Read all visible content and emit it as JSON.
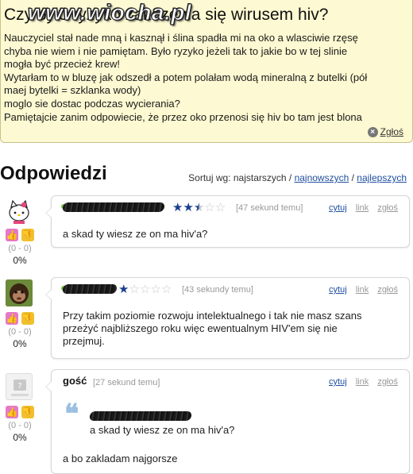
{
  "question": {
    "title": "Czy było ryzyko zakazenia się wirusem hiv?",
    "watermark": "www.wiocha.pl",
    "lines": [
      "Nauczyciel stał nade mną i kasznął i ślina spadła mi na oko a wlasciwie rzęsę",
      "chyba nie wiem i nie pamiętam. Było ryzyko jeżeli tak to jakie bo w tej slinie",
      "mogła być przecież krew!",
      "Wytarłam to w bluzę jak odszedł a potem polałam wodą mineralną z butelki (pół",
      "maej bytelki = szklanka wody)",
      "moglo sie dostac podczas wycierania?",
      "Pamiętajcie zanim odpowiecie, że przez oko przenosi się hiv bo tam jest blona"
    ],
    "report_label": "Zgłoś",
    "report_icon": "close-icon"
  },
  "answers_header": {
    "title": "Odpowiedzi",
    "sort_label": "Sortuj wg: najstarszych /",
    "sort_newest": "najnowszych",
    "sort_sep": "/",
    "sort_best": "najlepszych"
  },
  "answers": [
    {
      "avatar": "hello-kitty-avatar",
      "rating": 2.5,
      "stars": [
        "★",
        "★",
        "★",
        "☆",
        "☆"
      ],
      "time": "[47 sekund temu]",
      "actions": [
        "cytuj",
        "link",
        "zgłoś"
      ],
      "text_lines": [
        "a skad ty wiesz ze on ma hiv'a?"
      ],
      "score": "(0 - 0)",
      "percent": "0%"
    },
    {
      "avatar": "monkey-avatar",
      "rating": 1,
      "stars": [
        "★",
        "☆",
        "☆",
        "☆",
        "☆"
      ],
      "time": "[43 sekundy temu]",
      "actions": [
        "cytuj",
        "link",
        "zgłoś"
      ],
      "text_lines": [
        "Przy takim poziomie rozwoju intelektualnego i tak nie masz szans",
        "przeżyć najbliższego roku więc ewentualnym HIV'em się nie",
        "przejmuj."
      ],
      "score": "(0 - 0)",
      "percent": "0%"
    },
    {
      "avatar": "guest-avatar",
      "author": "gość",
      "time": "[27 sekund temu]",
      "actions": [
        "cytuj",
        "link",
        "zgłoś"
      ],
      "quote_text": "a skad ty wiesz ze on ma hiv'a?",
      "text_lines": [
        "a bo zakladam najgorsze"
      ],
      "score": "(0 - 0)",
      "percent": "0%"
    }
  ],
  "colors": {
    "question_bg": "#fdf9d2",
    "link": "#1f4fa0",
    "star_on": "#1b3f8f",
    "thumb_up": "#e678c8",
    "thumb_down": "#f0c12e"
  }
}
